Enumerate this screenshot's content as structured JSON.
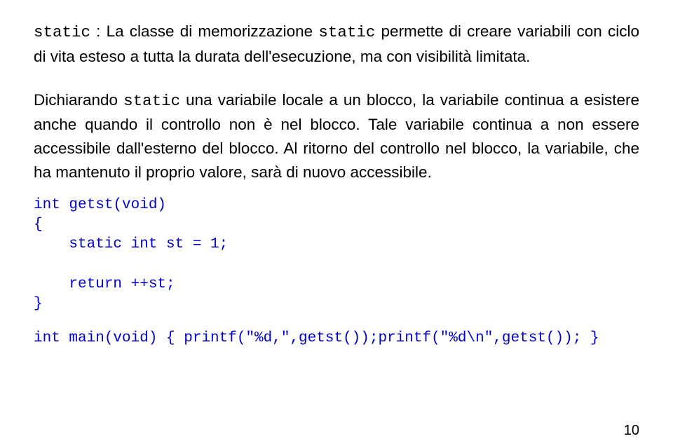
{
  "p1": {
    "code1": "static",
    "t1": " : La classe di memorizzazione ",
    "code2": "static",
    "t2": " permette di creare variabili con ciclo di vita esteso a tutta la durata dell'esecuzione, ma con visibilità limitata."
  },
  "p2": {
    "t1": "Dichiarando ",
    "code1": "static",
    "t2": " una variabile locale a un blocco, la variabile continua a esistere anche quando il controllo non è nel blocco. Tale variabile continua a non essere accessibile dall'esterno del blocco. Al ritorno del controllo nel blocco, la variabile, che ha mantenuto il proprio valore, sarà di nuovo accessibile."
  },
  "code": {
    "block": "int getst(void)\n{\n    static int st = 1;\n\n    return ++st;\n}",
    "main": "int main(void) { printf(\"%d,\",getst());printf(\"%d\\n\",getst()); }"
  },
  "pageNum": "10"
}
